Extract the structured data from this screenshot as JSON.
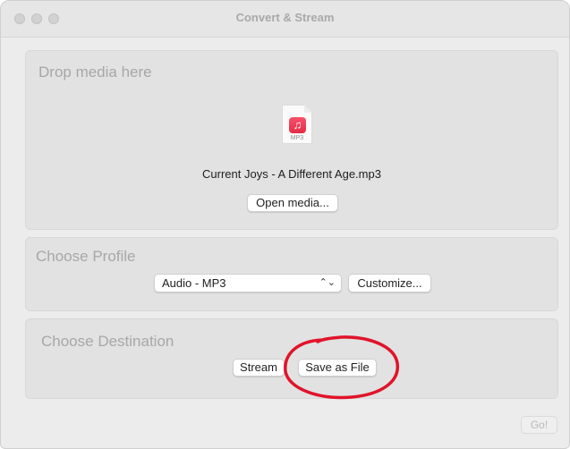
{
  "window": {
    "title": "Convert & Stream"
  },
  "drop": {
    "heading": "Drop media here",
    "file_type": "MP3",
    "file_name": "Current Joys - A Different Age.mp3",
    "open_button": "Open media..."
  },
  "profile": {
    "heading": "Choose Profile",
    "selected": "Audio - MP3",
    "customize_button": "Customize..."
  },
  "destination": {
    "heading": "Choose Destination",
    "stream_button": "Stream",
    "save_button": "Save as File"
  },
  "go_button": "Go!",
  "annotation": {
    "color": "#e0142a",
    "shape": "hand-drawn-circle",
    "target": "Save as File"
  },
  "icons": {
    "file": "mp3-file-icon",
    "music": "music-note-icon",
    "select_arrows": "up-down-chevron-icon"
  }
}
